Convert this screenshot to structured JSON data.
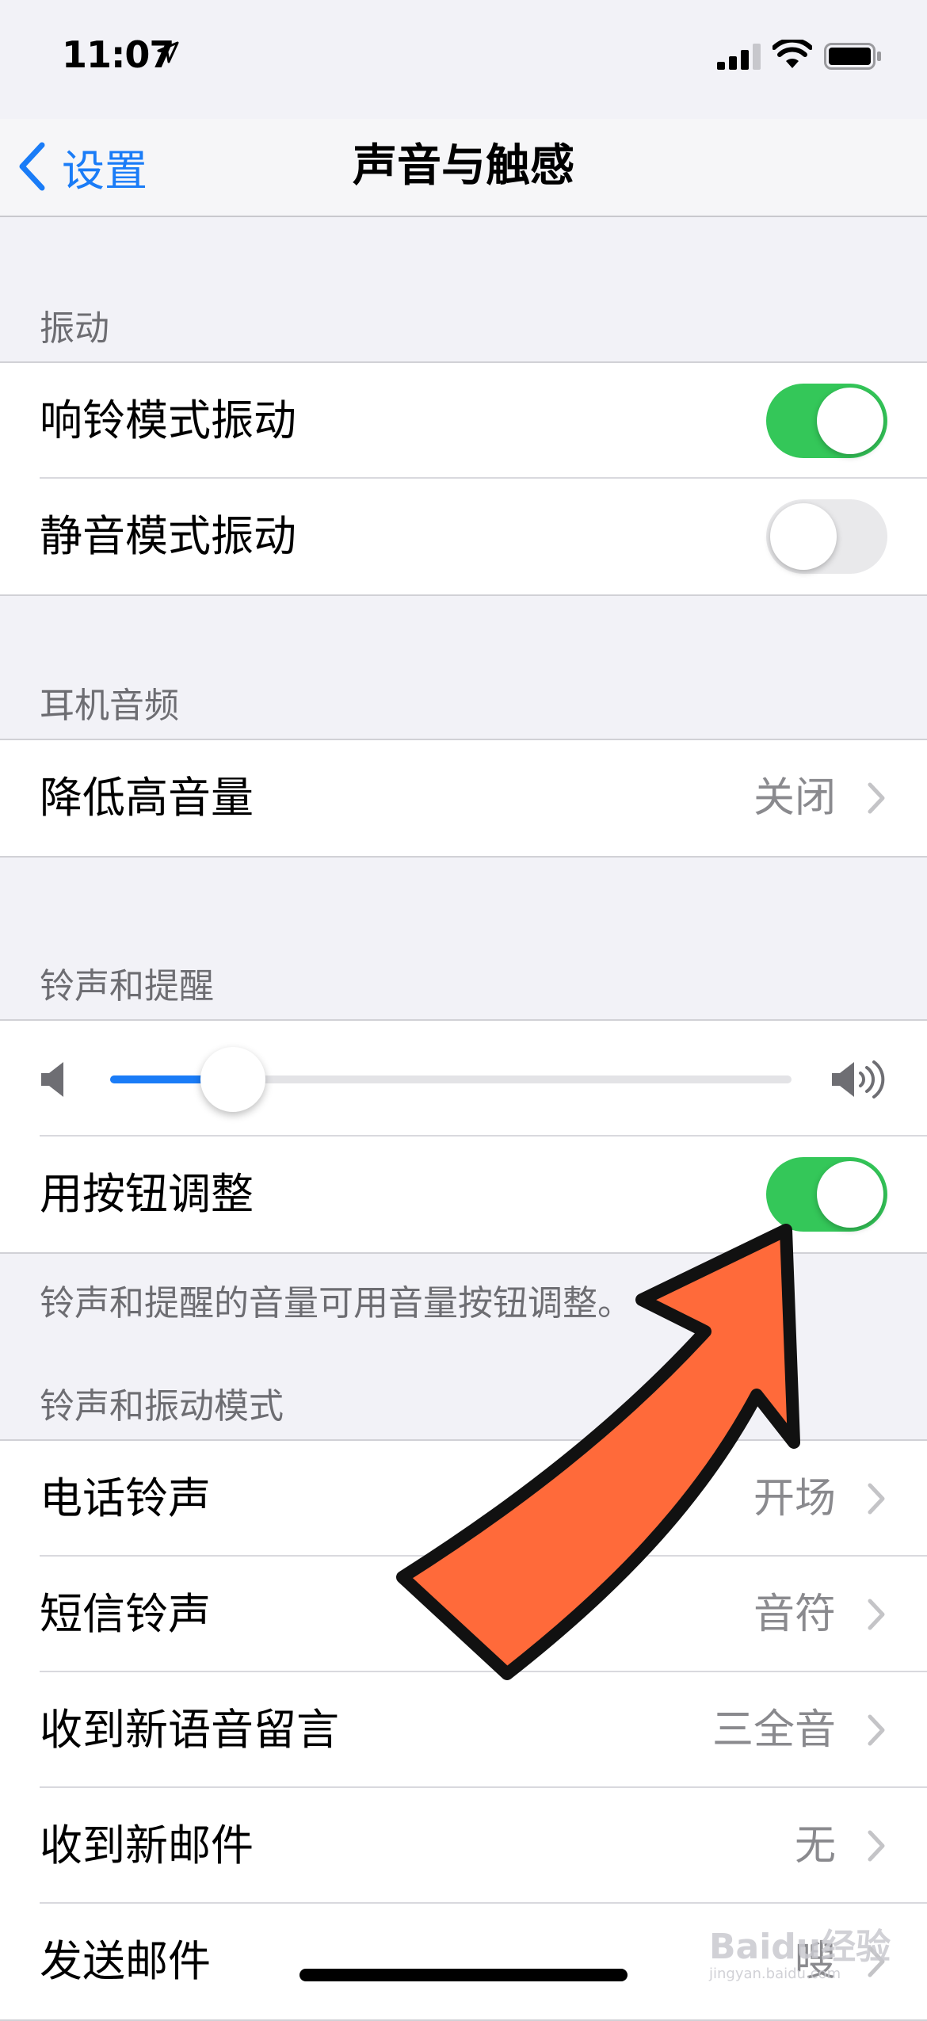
{
  "status": {
    "time": "11:07"
  },
  "nav": {
    "back_label": "设置",
    "title": "声音与触感"
  },
  "sections": {
    "vibration": {
      "header": "振动",
      "ring_vibrate": {
        "label": "响铃模式振动",
        "on": true
      },
      "silent_vibrate": {
        "label": "静音模式振动",
        "on": false
      }
    },
    "headphone": {
      "header": "耳机音频",
      "reduce_loud": {
        "label": "降低高音量",
        "value": "关闭"
      }
    },
    "ringer": {
      "header": "铃声和提醒",
      "volume_level": 0.18,
      "change_with_buttons": {
        "label": "用按钮调整",
        "on": true
      },
      "footer": "铃声和提醒的音量可用音量按钮调整。"
    },
    "patterns": {
      "header": "铃声和振动模式",
      "items": [
        {
          "label": "电话铃声",
          "value": "开场"
        },
        {
          "label": "短信铃声",
          "value": "音符"
        },
        {
          "label": "收到新语音留言",
          "value": "三全音"
        },
        {
          "label": "收到新邮件",
          "value": "无"
        },
        {
          "label": "发送邮件",
          "value": "嗖"
        }
      ]
    }
  },
  "watermark": {
    "text": "Baidu经验",
    "sub": "jingyan.baidu.com"
  },
  "colors": {
    "accent": "#1a7cf7",
    "toggle_on": "#34c759",
    "arrow": "#ff6a3a"
  }
}
